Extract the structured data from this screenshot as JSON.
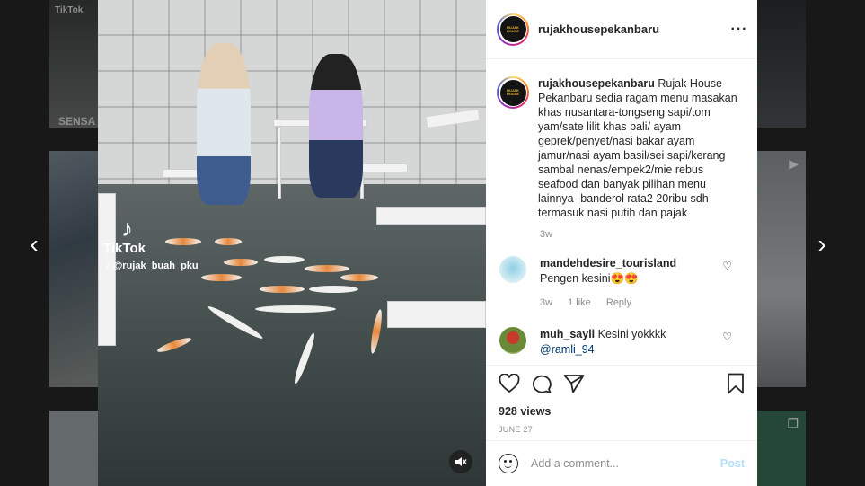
{
  "background": {
    "thumb1_text": "SENSA",
    "thumb1_brand": "TikTok"
  },
  "nav": {
    "prev_icon": "chevron-left-icon",
    "next_icon": "chevron-right-icon"
  },
  "media": {
    "watermark_brand": "TikTok",
    "watermark_user": "@rujak_buah_pku",
    "mute_icon": "speaker-muted-icon"
  },
  "post": {
    "header_username": "rujakhousepekanbaru",
    "avatar_text": "RUJAK HOUSE",
    "caption_username": "rujakhousepekanbaru",
    "caption_text": "Rujak House Pekanbaru sedia ragam menu masakan khas nusantara-tongseng sapi/tom yam/sate lilit khas bali/ ayam geprek/penyet/nasi bakar ayam jamur/nasi ayam basil/sei sapi/kerang sambal nenas/empek2/mie rebus seafood dan banyak pilihan menu lainnya- banderol rata2 20ribu sdh termasuk nasi putih dan pajak",
    "caption_age": "3w",
    "comments": [
      {
        "username": "mandehdesire_tourisland",
        "text": "Pengen kesini😍😍",
        "age": "3w",
        "likes": "1 like",
        "reply": "Reply"
      },
      {
        "username": "muh_sayli",
        "text": "Kesini yokkkk",
        "mention": "@ramli_94"
      }
    ],
    "views": "928 views",
    "date": "JUNE 27",
    "add_comment_placeholder": "Add a comment...",
    "post_label": "Post"
  },
  "colors": {
    "link": "#00376b",
    "muted": "#8e8e8e",
    "post_button": "#b2dffc"
  }
}
